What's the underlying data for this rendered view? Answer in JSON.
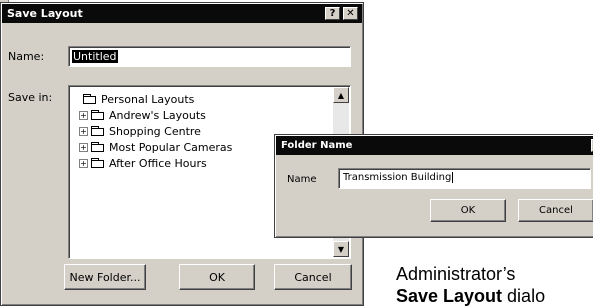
{
  "save_dialog": {
    "title": "Save Layout",
    "help_btn": "?",
    "close_btn": "✕",
    "name_label": "Name:",
    "name_value": "Untitled",
    "save_in_label": "Save in:",
    "tree": [
      {
        "label": "Personal Layouts",
        "expandable": false,
        "level": 0
      },
      {
        "label": "Andrew's Layouts",
        "expandable": true,
        "level": 1
      },
      {
        "label": "Shopping Centre",
        "expandable": true,
        "level": 1
      },
      {
        "label": "Most Popular Cameras",
        "expandable": true,
        "level": 1
      },
      {
        "label": "After Office Hours",
        "expandable": true,
        "level": 1
      }
    ],
    "new_folder_label": "New Folder...",
    "ok_label": "OK",
    "cancel_label": "Cancel"
  },
  "folder_dialog": {
    "title": "Folder Name",
    "close_btn": "✕",
    "name_label": "Name",
    "name_value": "Transmission Building",
    "ok_label": "OK",
    "cancel_label": "Cancel"
  },
  "caption": {
    "line1": "Administrator’s",
    "line2_bold": "Save Layout",
    "line2_rest": " dialo"
  },
  "colors": {
    "titlebar": "#0a0a0a",
    "dialog_face": "#d4d0c8"
  },
  "icons": {
    "folder": "folder-icon",
    "expand": "expand-plus-icon",
    "scroll_up": "scroll-up-arrow-icon",
    "scroll_down": "scroll-down-arrow-icon"
  }
}
